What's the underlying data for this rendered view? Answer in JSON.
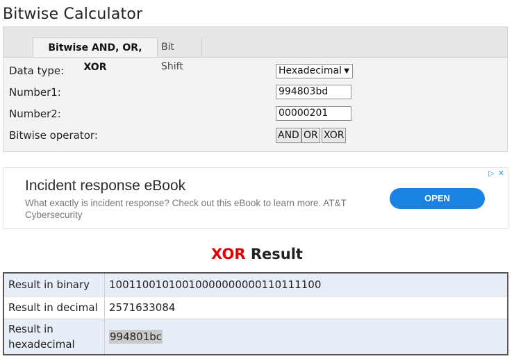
{
  "page": {
    "title": "Bitwise Calculator"
  },
  "tabs": [
    {
      "label": "Bitwise AND, OR, XOR",
      "active": true
    },
    {
      "label": "Bit Shift",
      "active": false
    }
  ],
  "form": {
    "data_type_label": "Data type:",
    "data_type_value": "Hexadecimal",
    "number1_label": "Number1:",
    "number1_value": "994803bd",
    "number2_label": "Number2:",
    "number2_value": "00000201",
    "operator_label": "Bitwise operator:",
    "operators": [
      "AND",
      "OR",
      "XOR"
    ]
  },
  "ad": {
    "title": "Incident response eBook",
    "description": "What exactly is incident response? Check out this eBook to learn more. AT&T Cybersecurity",
    "cta": "OPEN"
  },
  "result": {
    "operator": "XOR",
    "heading_suffix": "Result",
    "rows": [
      {
        "label": "Result in binary",
        "value": "10011001010010000000000110111100"
      },
      {
        "label": "Result in decimal",
        "value": "2571633084"
      },
      {
        "label": "Result in hexadecimal",
        "value": "994801bc"
      }
    ]
  },
  "colors": {
    "operator_highlight": "#e00000",
    "cta_background": "#1a82e2"
  }
}
